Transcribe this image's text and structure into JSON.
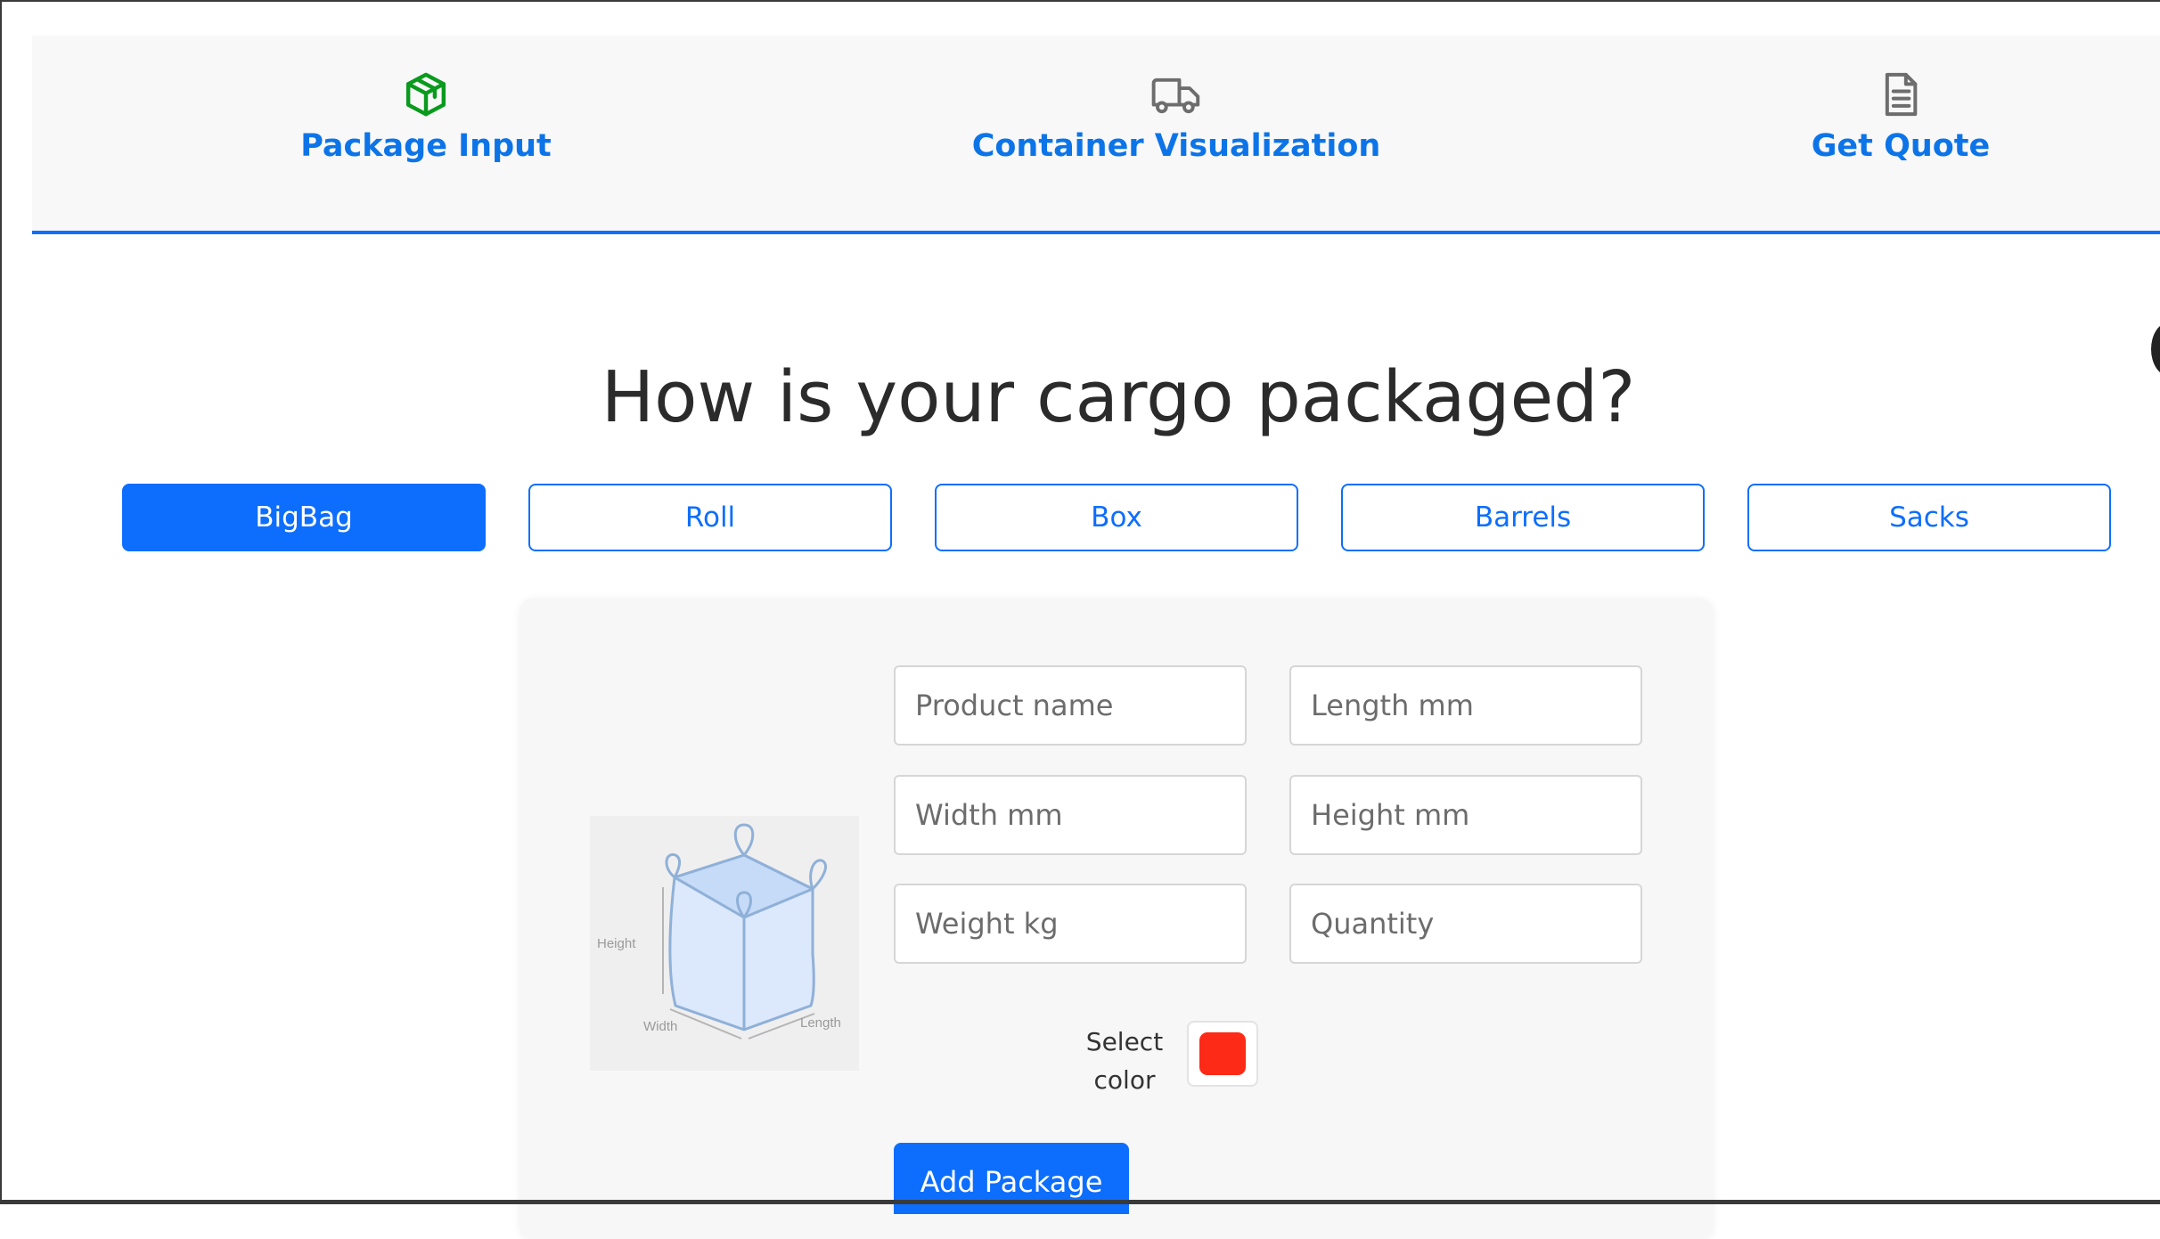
{
  "stepper": {
    "steps": [
      {
        "label": "Package Input",
        "icon": "package-icon",
        "icon_color": "#0a9a1d"
      },
      {
        "label": "Container Visualization",
        "icon": "truck-icon",
        "icon_color": "#6d6d6d"
      },
      {
        "label": "Get Quote",
        "icon": "document-icon",
        "icon_color": "#6d6d6d"
      }
    ],
    "accent_color": "#0d6efd"
  },
  "main": {
    "title": "How is your cargo packaged?",
    "package_types": [
      {
        "label": "BigBag",
        "selected": true
      },
      {
        "label": "Roll",
        "selected": false
      },
      {
        "label": "Box",
        "selected": false
      },
      {
        "label": "Barrels",
        "selected": false
      },
      {
        "label": "Sacks",
        "selected": false
      }
    ]
  },
  "form": {
    "illustration": {
      "icon": "bigbag-illustration",
      "labels": {
        "height": "Height",
        "width": "Width",
        "length": "Length"
      }
    },
    "fields": {
      "product_name": {
        "placeholder": "Product name",
        "value": ""
      },
      "length": {
        "placeholder": "Length mm",
        "value": ""
      },
      "width": {
        "placeholder": "Width mm",
        "value": ""
      },
      "height": {
        "placeholder": "Height mm",
        "value": ""
      },
      "weight": {
        "placeholder": "Weight kg",
        "value": ""
      },
      "quantity": {
        "placeholder": "Quantity",
        "value": ""
      }
    },
    "color": {
      "label_line1": "Select",
      "label_line2": "color",
      "value": "#fc2a16"
    },
    "add_button_label": "Add Package"
  }
}
